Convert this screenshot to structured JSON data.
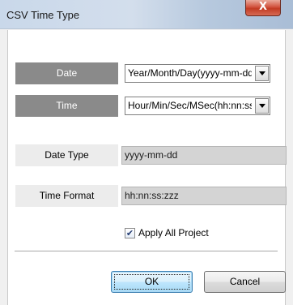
{
  "window": {
    "title": "CSV Time Type",
    "close_glyph": "X"
  },
  "date": {
    "label": "Date",
    "selected": "Year/Month/Day(yyyy-mm-dd)"
  },
  "time": {
    "label": "Time",
    "selected": "Hour/Min/Sec/MSec(hh:nn:ss:zzz)"
  },
  "date_type": {
    "label": "Date Type",
    "value": "yyyy-mm-dd"
  },
  "time_format": {
    "label": "Time Format",
    "value": "hh:nn:ss:zzz"
  },
  "apply_all": {
    "label": "Apply All Project",
    "checked": true
  },
  "buttons": {
    "ok": "OK",
    "cancel": "Cancel"
  },
  "colors": {
    "label_dark": "#8a8a8a",
    "label_light": "#ececec",
    "readonly_bg": "#d4d4d4",
    "close_red": "#c23b23"
  }
}
